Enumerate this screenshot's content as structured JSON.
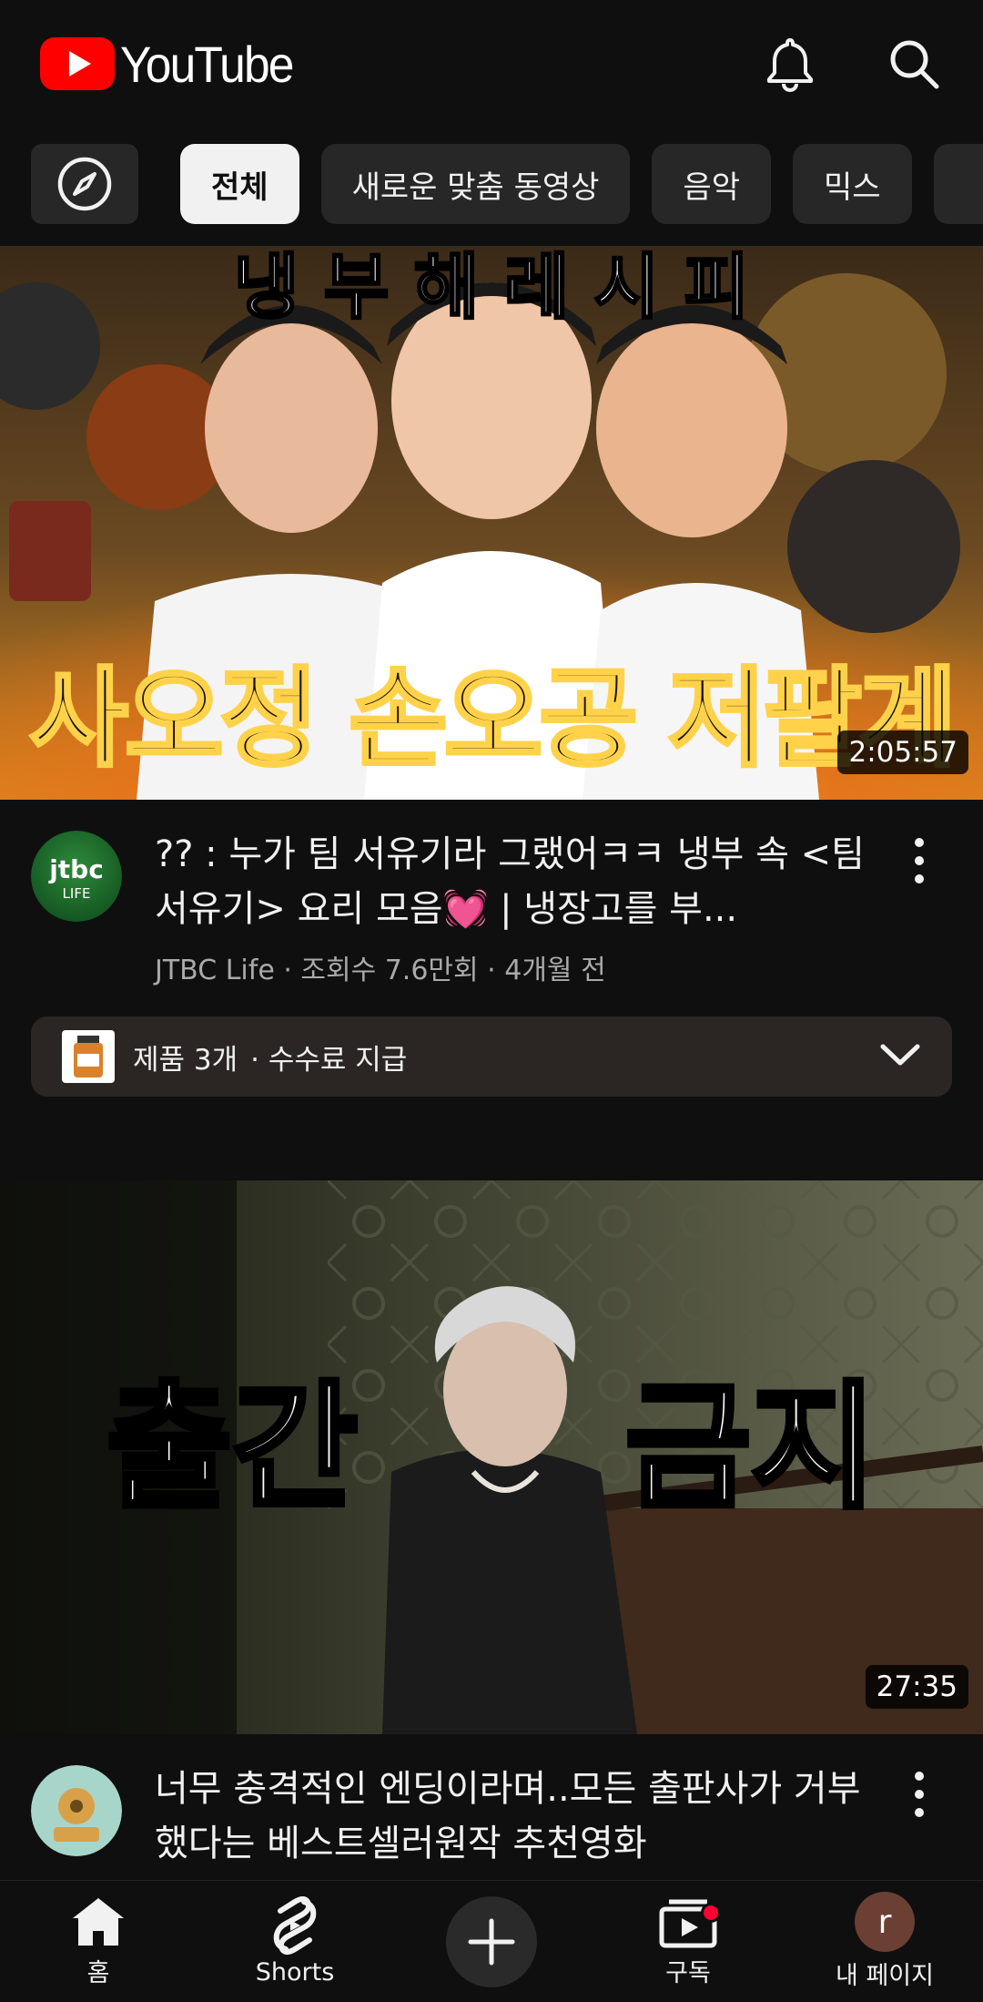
{
  "header": {
    "logo_text": "YouTube",
    "brand_color": "#ff0000",
    "notification_icon": "bell-icon",
    "search_icon": "search-icon"
  },
  "chips": {
    "explore_icon": "compass-icon",
    "items": [
      {
        "label": "전체",
        "active": true
      },
      {
        "label": "새로운 맞춤 동영상",
        "active": false
      },
      {
        "label": "음악",
        "active": false
      },
      {
        "label": "믹스",
        "active": false
      }
    ]
  },
  "video1": {
    "thumb_text_top": "냉 부 해 레 시 피",
    "thumb_text_bottom": "사오정 손오공 저팔계",
    "duration": "2:05:57",
    "channel_avatar_text": "jtbc",
    "channel_avatar_sub": "LIFE",
    "title": "?? : 누가 팀 서유기라 그랬어ㅋㅋ 냉부 속 <팀 서유기> 요리 모음💓 | 냉장고를 부...",
    "subtitle": "JTBC Life · 조회수 7.6만회 · 4개월 전",
    "products": {
      "label": "제품 3개",
      "fee": "· 수수료 지급"
    }
  },
  "video2": {
    "thumb_text_left": "출간",
    "thumb_text_right": "금지",
    "duration": "27:35",
    "title": "너무 충격적인 엔딩이라며..모든 출판사가 거부했다는 베스트셀러원작 추천영화"
  },
  "bottom_nav": {
    "home": "홈",
    "shorts": "Shorts",
    "subscriptions": "구독",
    "you": "내 페이지",
    "profile_initial": "r"
  }
}
